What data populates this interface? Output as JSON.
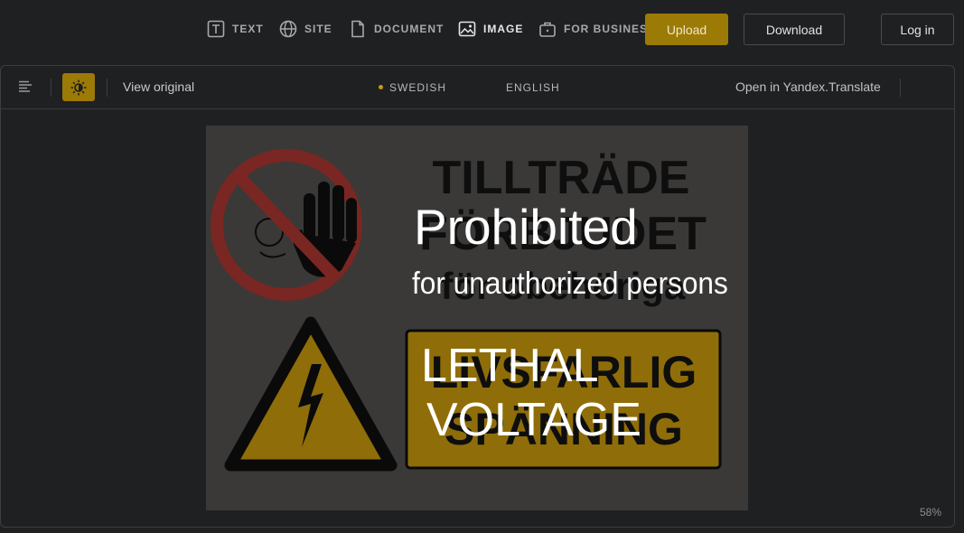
{
  "nav": {
    "items": [
      {
        "label": "TEXT",
        "icon": "text-icon"
      },
      {
        "label": "SITE",
        "icon": "globe-icon"
      },
      {
        "label": "DOCUMENT",
        "icon": "document-icon"
      },
      {
        "label": "IMAGE",
        "icon": "image-icon",
        "active": true
      },
      {
        "label": "FOR BUSINESS",
        "icon": "briefcase-icon"
      }
    ],
    "upload_label": "Upload",
    "download_label": "Download",
    "login_label": "Log in"
  },
  "toolbar": {
    "view_original_label": "View original",
    "source_lang": "SWEDISH",
    "target_lang": "ENGLISH",
    "open_in_label": "Open in Yandex.Translate"
  },
  "image": {
    "original_text": [
      "TILLTRÄDE",
      "FÖRBJUDET",
      "för obehöriga",
      "LIVSFARLIG",
      "SPÄNNING"
    ],
    "translated_text": {
      "line1": "Prohibited",
      "line2": "for unauthorized persons",
      "line3": "LETHAL",
      "line4": "VOLTAGE"
    }
  },
  "zoom_label": "58%",
  "colors": {
    "accent": "#9c7a06",
    "background": "#1f2022",
    "sign_red": "#7a2622",
    "sign_yellow": "#8f6d08"
  }
}
